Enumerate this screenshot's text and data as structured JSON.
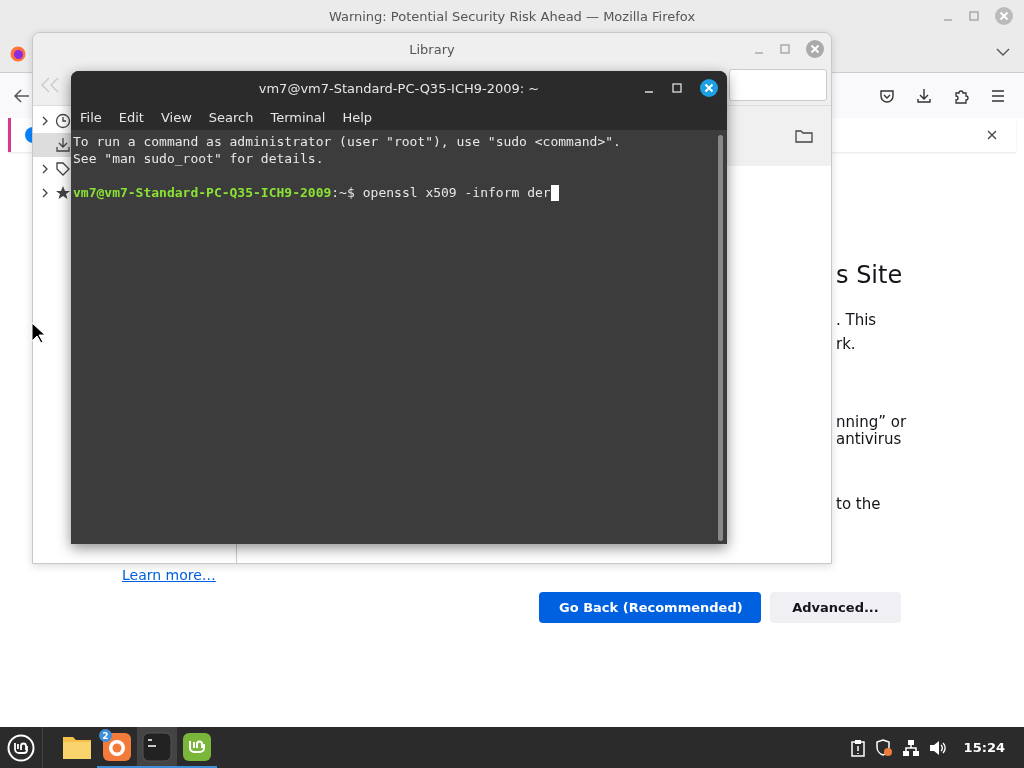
{
  "firefox": {
    "title": "Warning: Potential Security Risk Ahead — Mozilla Firefox",
    "page": {
      "heading": "s Site",
      "paragraphs": [
        [
          ". This",
          "rk."
        ],
        [
          "nning” or",
          "antivirus"
        ],
        [
          "to the"
        ]
      ],
      "link": "Learn more…",
      "buttons": [
        {
          "label": "Go Back (Recommended)",
          "kind": "primary"
        },
        {
          "label": "Advanced...",
          "kind": "secondary"
        }
      ]
    }
  },
  "library": {
    "title": "Library"
  },
  "terminal": {
    "title": "vm7@vm7-Standard-PC-Q35-ICH9-2009: ~",
    "menu": [
      "File",
      "Edit",
      "View",
      "Search",
      "Terminal",
      "Help"
    ],
    "lines": [
      {
        "kind": "output",
        "text": "To run a command as administrator (user \"root\"), use \"sudo <command>\"."
      },
      {
        "kind": "output",
        "text": "See \"man sudo_root\" for details."
      },
      {
        "kind": "prompt",
        "user": "vm7@vm7-Standard-PC-Q35-ICH9-2009",
        "path": ":~$",
        "command": "openssl x509 -inform der"
      }
    ]
  },
  "taskbar": {
    "apps": [
      {
        "kind": "files",
        "running": false,
        "selected": false
      },
      {
        "kind": "firefox",
        "running": true,
        "selected": false,
        "badge": "2"
      },
      {
        "kind": "terminal",
        "running": true,
        "selected": true
      },
      {
        "kind": "mint",
        "running": true,
        "selected": false
      }
    ],
    "clock": "15:24"
  }
}
